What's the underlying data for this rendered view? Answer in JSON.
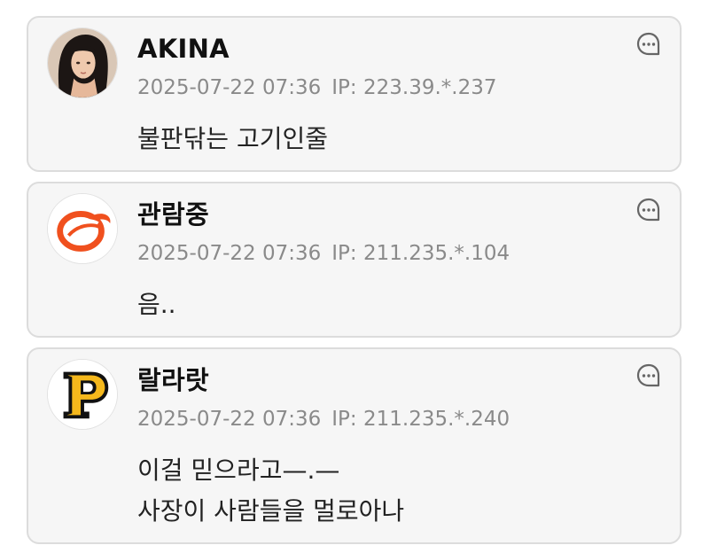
{
  "comments": [
    {
      "author": "AKINA",
      "datetime": "2025-07-22 07:36",
      "ip": "IP: 223.39.*.237",
      "lines": [
        "불판닦는 고기인줄"
      ],
      "avatar_icon": "profile-photo"
    },
    {
      "author": "관람중",
      "datetime": "2025-07-22 07:36",
      "ip": "IP: 211.235.*.104",
      "lines": [
        "음.."
      ],
      "avatar_icon": "orange-swirl-logo"
    },
    {
      "author": "랄라랏",
      "datetime": "2025-07-22 07:36",
      "ip": "IP: 211.235.*.240",
      "lines": [
        "이걸 믿으라고—.—",
        "사장이 사람들을 멀로아나"
      ],
      "avatar_icon": "pittsburgh-p-logo"
    }
  ],
  "colors": {
    "card_bg": "#f6f6f6",
    "card_border": "#dcdcdc",
    "meta_text": "#8a8a8a",
    "logo_orange": "#f0501e",
    "logo_gold": "#f5b81c"
  },
  "reply_icon": "speech-bubble-icon"
}
